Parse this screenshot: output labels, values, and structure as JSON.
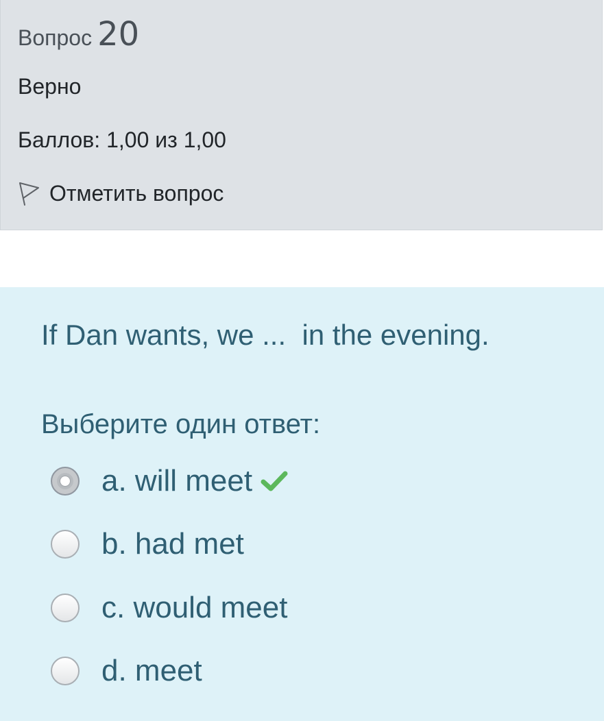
{
  "info": {
    "question_word": "Вопрос",
    "question_number": "20",
    "state": "Верно",
    "grade": "Баллов: 1,00 из 1,00",
    "flag_label": "Отметить вопрос"
  },
  "question": {
    "text": "If Dan wants, we ...  in the evening.",
    "prompt": "Выберите один ответ:",
    "options": [
      {
        "label": "a. will meet",
        "selected": true,
        "correct": true
      },
      {
        "label": "b. had met",
        "selected": false
      },
      {
        "label": "c. would meet",
        "selected": false
      },
      {
        "label": "d. meet",
        "selected": false
      }
    ]
  },
  "colors": {
    "info_background": "#dee2e6",
    "content_background": "#def2f8",
    "text_teal": "#2f5f73",
    "correct_green": "#5cb85c"
  },
  "icons": {
    "flag": "flag-icon",
    "correct": "check-icon"
  }
}
